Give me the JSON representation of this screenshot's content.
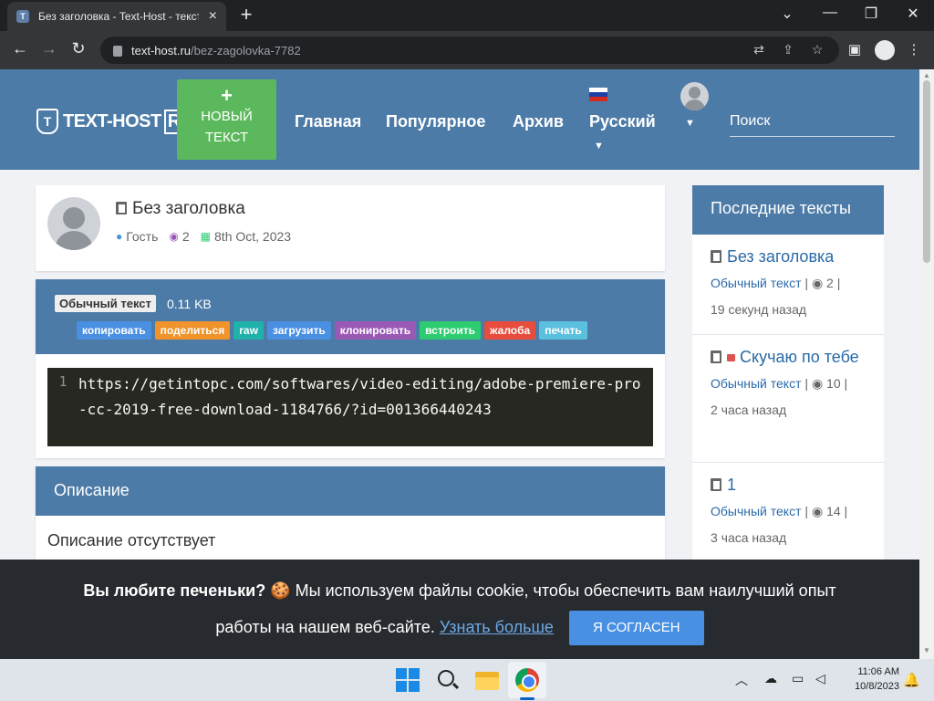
{
  "browser": {
    "tab_title": "Без заголовка - Text-Host - текст",
    "tab_close": "×",
    "new_tab": "+",
    "url_host": "text-host.ru",
    "url_path": "/bez-zagolovka-7782",
    "back": "←",
    "forward": "→",
    "reload": "↻",
    "minimize": "⌄",
    "min2": "—",
    "restore": "❐",
    "close": "✕",
    "translate_icon": "⇄",
    "share_icon": "⇪",
    "star_icon": "☆",
    "sidepanel_icon": "▣",
    "menu_icon": "⋮"
  },
  "site": {
    "logo_text": "TEXT-HOST",
    "logo_ru": "RU",
    "logo_letter": "T",
    "new_text_plus": "+",
    "new_text_line1": "НОВЫЙ",
    "new_text_line2": "ТЕКСТ",
    "nav": [
      "Главная",
      "Популярное",
      "Архив"
    ],
    "language": "Русский",
    "caret": "▼",
    "search_placeholder": "Поиск"
  },
  "paste": {
    "title": "Без заголовка",
    "author": "Гость",
    "views": "2",
    "date": "8th Oct, 2023",
    "language": "Обычный текст",
    "size": "0.11 KB",
    "actions": [
      {
        "label": "копировать",
        "color": "#4a90e2"
      },
      {
        "label": "поделиться",
        "color": "#f0932b"
      },
      {
        "label": "raw",
        "color": "#20b2aa"
      },
      {
        "label": "загрузить",
        "color": "#4a90e2"
      },
      {
        "label": "клонировать",
        "color": "#9b59b6"
      },
      {
        "label": "встроить",
        "color": "#2ecc71"
      },
      {
        "label": "жалоба",
        "color": "#e74c3c"
      },
      {
        "label": "печать",
        "color": "#5bc0de"
      }
    ],
    "line_number": "1",
    "code": "https://getintopc.com/softwares/video-editing/adobe-premiere-pro-cc-2019-free-download-1184766/?id=001366440243"
  },
  "description": {
    "heading": "Описание",
    "body": "Описание отсутствует"
  },
  "sidebar": {
    "heading": "Последние тексты",
    "items": [
      {
        "title": "Без заголовка",
        "type": "Обычный текст",
        "views": "2",
        "time": "19 секунд назад",
        "locked": false
      },
      {
        "title": "Скучаю по тебе",
        "type": "Обычный текст",
        "views": "10",
        "time": "2 часа назад",
        "locked": true
      },
      {
        "title": "1",
        "type": "Обычный текст",
        "views": "14",
        "time": "3 часа назад",
        "locked": false
      }
    ]
  },
  "cookie": {
    "question": "Вы любите печеньки? 🍪",
    "text_line1": " Мы используем файлы cookie, чтобы обеспечить вам наилучший опыт",
    "text_line2": "работы на нашем веб-сайте. ",
    "link": "Узнать больше",
    "button": "Я СОГЛАСЕН"
  },
  "taskbar": {
    "time": "11:06 AM",
    "date": "10/8/2023",
    "tray_chevron": "︿",
    "bell": "🔔"
  },
  "colors": {
    "header_blue": "#4d7ba7",
    "new_text_green": "#5cb85c",
    "link_blue": "#2a6aa8"
  }
}
